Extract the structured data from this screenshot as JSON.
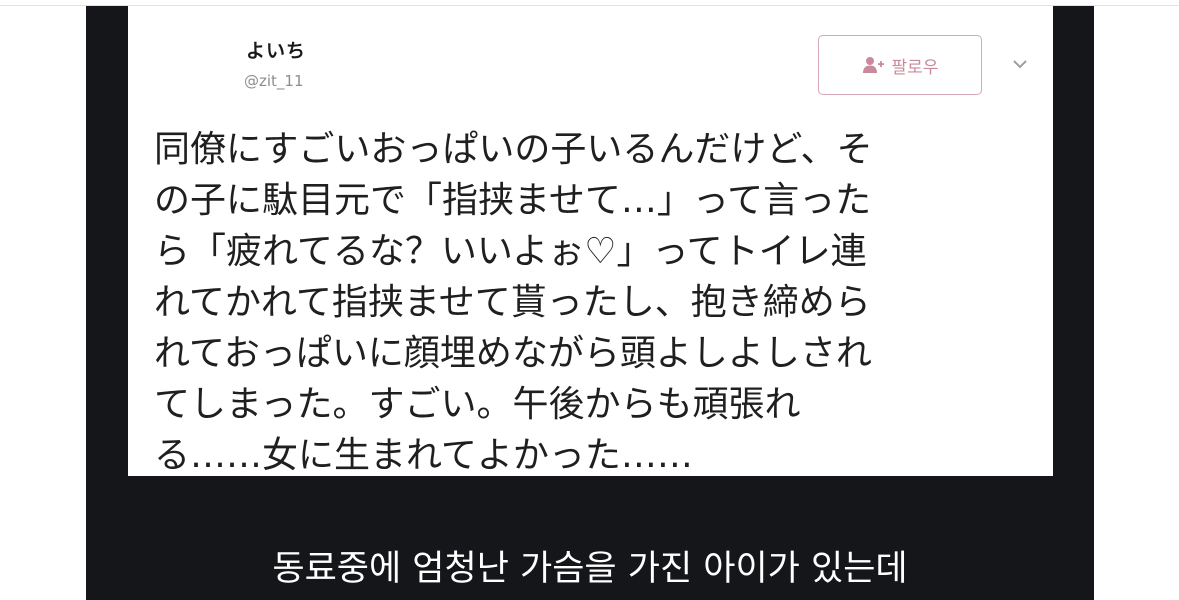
{
  "tweet": {
    "display_name": "よいち",
    "handle": "@zit_11",
    "follow_label": "팔로우",
    "text": "同僚にすごいおっぱいの子いるんだけど、そ\nの子に駄目元で「指挟ませて…」って言った\nら「疲れてるな？いいよぉ♡」ってトイレ連\nれてかれて指挟ませて貰ったし、抱き締めら\nれておっぱいに顔埋めながら頭よしよしされ\nてしまった。すごい。午後からも頑張れ\nる……女に生まれてよかった……"
  },
  "caption": "동료중에 엄청난 가슴을 가진 아이가 있는데",
  "icons": {
    "follow": "add-user-icon",
    "more": "chevron-down-icon"
  },
  "colors": {
    "panel_background": "#15161a",
    "follow_accent": "#c98a9b"
  }
}
